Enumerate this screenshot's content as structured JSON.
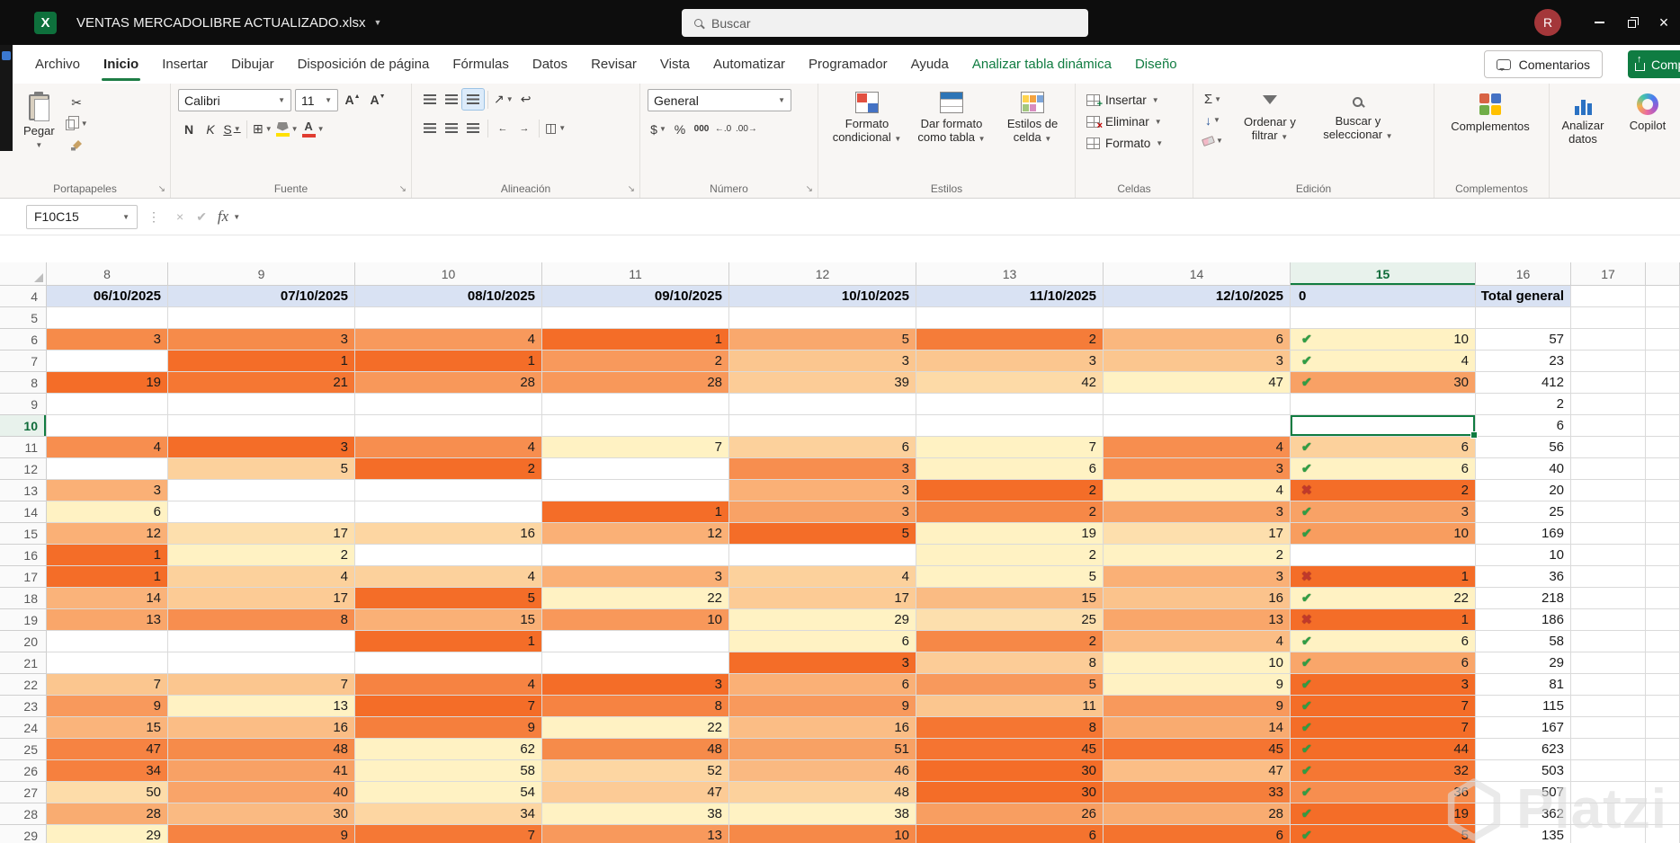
{
  "titlebar": {
    "filename": "VENTAS MERCADOLIBRE ACTUALIZADO.xlsx",
    "search_placeholder": "Buscar",
    "avatar_initial": "R"
  },
  "tabs": [
    {
      "label": "Archivo",
      "state": "normal"
    },
    {
      "label": "Inicio",
      "state": "active"
    },
    {
      "label": "Insertar",
      "state": "normal"
    },
    {
      "label": "Dibujar",
      "state": "normal"
    },
    {
      "label": "Disposición de página",
      "state": "normal"
    },
    {
      "label": "Fórmulas",
      "state": "normal"
    },
    {
      "label": "Datos",
      "state": "normal"
    },
    {
      "label": "Revisar",
      "state": "normal"
    },
    {
      "label": "Vista",
      "state": "normal"
    },
    {
      "label": "Automatizar",
      "state": "normal"
    },
    {
      "label": "Programador",
      "state": "normal"
    },
    {
      "label": "Ayuda",
      "state": "normal"
    },
    {
      "label": "Analizar tabla dinámica",
      "state": "contextual"
    },
    {
      "label": "Diseño",
      "state": "contextual"
    }
  ],
  "tab_actions": {
    "comments": "Comentarios",
    "share": "Comp"
  },
  "ribbon": {
    "clipboard": {
      "label": "Portapapeles",
      "paste": "Pegar"
    },
    "font": {
      "label": "Fuente",
      "family": "Calibri",
      "size": "11",
      "bold": "N",
      "italic": "K",
      "underline": "S"
    },
    "alignment": {
      "label": "Alineación"
    },
    "number": {
      "label": "Número",
      "format": "General",
      "currency": "$",
      "percent": "%",
      "thousands": "000",
      "dec_inc": "←.0",
      "dec_dec": ".00→"
    },
    "styles": {
      "label": "Estilos",
      "conditional": "Formato condicional",
      "table": "Dar formato como tabla",
      "cellstyles": "Estilos de celda"
    },
    "cells": {
      "label": "Celdas",
      "insert": "Insertar",
      "delete": "Eliminar",
      "format": "Formato"
    },
    "editing": {
      "label": "Edición",
      "sort": "Ordenar y filtrar",
      "find": "Buscar y seleccionar"
    },
    "addins": {
      "label": "Complementos",
      "button": "Complementos"
    },
    "analyze_button": "Analizar datos",
    "copilot_button": "Copilot"
  },
  "formula_bar": {
    "name_box": "F10C15",
    "fx": "fx"
  },
  "sheet": {
    "col_headers": [
      "8",
      "9",
      "10",
      "11",
      "12",
      "13",
      "14",
      "15",
      "16",
      "17",
      ""
    ],
    "header_row_num": "4",
    "column_titles": [
      "06/10/2025",
      "07/10/2025",
      "08/10/2025",
      "09/10/2025",
      "10/10/2025",
      "11/10/2025",
      "12/10/2025",
      "0",
      "Total general",
      ""
    ],
    "heatmap": {
      "min_color": "#F46D28",
      "max_color": "#FFF2C3"
    },
    "icon_colors": {
      "check": "#2F9E44",
      "cross": "#C0392B"
    },
    "selection": {
      "row": "10",
      "col": "15"
    },
    "rows": [
      {
        "num": "5",
        "values": [
          null,
          null,
          null,
          null,
          null,
          null,
          null,
          null
        ],
        "icon": null,
        "total": null
      },
      {
        "num": "6",
        "values": [
          3,
          3,
          4,
          1,
          5,
          2,
          6,
          10
        ],
        "icon": "check",
        "total": 57
      },
      {
        "num": "7",
        "values": [
          null,
          1,
          1,
          2,
          3,
          3,
          3,
          4
        ],
        "icon": "check",
        "total": 23
      },
      {
        "num": "8",
        "values": [
          19,
          21,
          28,
          28,
          39,
          42,
          47,
          30
        ],
        "icon": "check",
        "total": 412
      },
      {
        "num": "9",
        "values": [
          null,
          null,
          null,
          null,
          null,
          null,
          null,
          null
        ],
        "icon": null,
        "total": 2
      },
      {
        "num": "10",
        "values": [
          null,
          null,
          null,
          null,
          null,
          null,
          null,
          null
        ],
        "icon": null,
        "total": 6
      },
      {
        "num": "11",
        "values": [
          4,
          3,
          4,
          7,
          6,
          7,
          4,
          6
        ],
        "icon": "check",
        "total": 56
      },
      {
        "num": "12",
        "values": [
          null,
          5,
          2,
          null,
          3,
          6,
          3,
          6
        ],
        "icon": "check",
        "total": 40
      },
      {
        "num": "13",
        "values": [
          3,
          null,
          null,
          null,
          3,
          2,
          4,
          2
        ],
        "icon": "cross",
        "total": 20
      },
      {
        "num": "14",
        "values": [
          6,
          null,
          null,
          1,
          3,
          2,
          3,
          3
        ],
        "icon": "check",
        "total": 25
      },
      {
        "num": "15",
        "values": [
          12,
          17,
          16,
          12,
          5,
          19,
          17,
          10
        ],
        "icon": "check",
        "total": 169
      },
      {
        "num": "16",
        "values": [
          1,
          2,
          null,
          null,
          null,
          2,
          2,
          null
        ],
        "icon": null,
        "total": 10
      },
      {
        "num": "17",
        "values": [
          1,
          4,
          4,
          3,
          4,
          5,
          3,
          1
        ],
        "icon": "cross",
        "total": 36
      },
      {
        "num": "18",
        "values": [
          14,
          17,
          5,
          22,
          17,
          15,
          16,
          22
        ],
        "icon": "check",
        "total": 218
      },
      {
        "num": "19",
        "values": [
          13,
          8,
          15,
          10,
          29,
          25,
          13,
          1
        ],
        "icon": "cross",
        "total": 186
      },
      {
        "num": "20",
        "values": [
          null,
          null,
          1,
          null,
          6,
          2,
          4,
          6
        ],
        "icon": "check",
        "total": 58
      },
      {
        "num": "21",
        "values": [
          null,
          null,
          null,
          null,
          3,
          8,
          10,
          6
        ],
        "icon": "check",
        "total": 29
      },
      {
        "num": "22",
        "values": [
          7,
          7,
          4,
          3,
          6,
          5,
          9,
          3
        ],
        "icon": "check",
        "total": 81
      },
      {
        "num": "23",
        "values": [
          9,
          13,
          7,
          8,
          9,
          11,
          9,
          7
        ],
        "icon": "check",
        "total": 115
      },
      {
        "num": "24",
        "values": [
          15,
          16,
          9,
          22,
          16,
          8,
          14,
          7
        ],
        "icon": "check",
        "total": 167
      },
      {
        "num": "25",
        "values": [
          47,
          48,
          62,
          48,
          51,
          45,
          45,
          44
        ],
        "icon": "check",
        "total": 623
      },
      {
        "num": "26",
        "values": [
          34,
          41,
          58,
          52,
          46,
          30,
          47,
          32
        ],
        "icon": "check",
        "total": 503
      },
      {
        "num": "27",
        "values": [
          50,
          40,
          54,
          47,
          48,
          30,
          33,
          36
        ],
        "icon": "check",
        "total": 507
      },
      {
        "num": "28",
        "values": [
          28,
          30,
          34,
          38,
          38,
          26,
          28,
          19
        ],
        "icon": "check",
        "total": 362
      },
      {
        "num": "29",
        "values": [
          29,
          9,
          7,
          13,
          10,
          6,
          6,
          5
        ],
        "icon": "check",
        "total": 135
      }
    ]
  },
  "watermark": "Platzi"
}
